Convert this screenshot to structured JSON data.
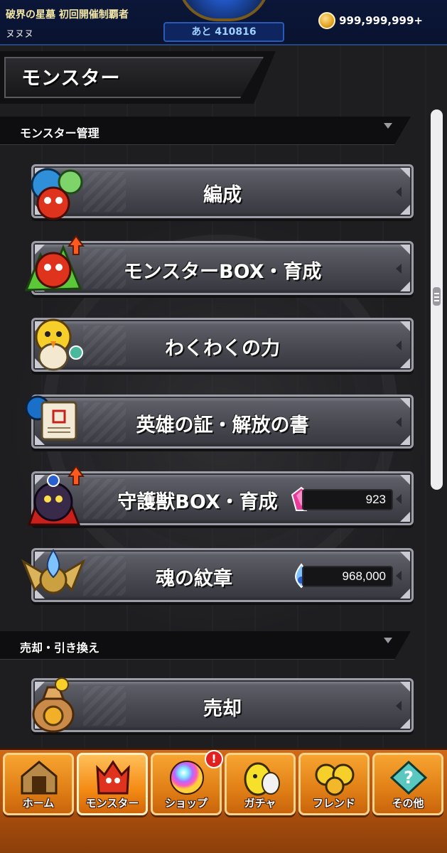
{
  "topbar": {
    "quest_title": "破界の星墓 初回開催制覇者",
    "user_name": "ヌヌヌ",
    "remaining": "あと 410816",
    "coin_value": "999,999,999+"
  },
  "page": {
    "title": "モンスター"
  },
  "sections": {
    "monster_management": "モンスター管理",
    "sell_exchange": "売却・引き換え"
  },
  "menu": {
    "formation": "編成",
    "monster_box": "モンスターBOX・育成",
    "wakuwaku": "わくわくの力",
    "hero_proof": "英雄の証・解放の書",
    "guardian_box": "守護獣BOX・育成",
    "guardian_count": "923",
    "soul_emblem": "魂の紋章",
    "soul_count": "968,000",
    "sell": "売却"
  },
  "tabs": [
    {
      "label": "ホーム"
    },
    {
      "label": "モンスター"
    },
    {
      "label": "ショップ"
    },
    {
      "label": "ガチャ"
    },
    {
      "label": "フレンド"
    },
    {
      "label": "その他"
    }
  ],
  "shop_badge": "!",
  "colors": {
    "accent_orange": "#e07f16",
    "button_gray": "#4a4b53",
    "topbar_navy": "#0b1638",
    "badge_red": "#e12020"
  },
  "icons": {
    "formation": "monster-group-icon",
    "monster_box": "red-dragon-upgrade-icon",
    "wakuwaku": "yellow-bird-icon",
    "hero_proof": "scroll-icon",
    "guardian_box": "dark-beast-upgrade-icon",
    "soul_emblem": "winged-flame-emblem-icon",
    "sell": "money-bag-icon"
  }
}
